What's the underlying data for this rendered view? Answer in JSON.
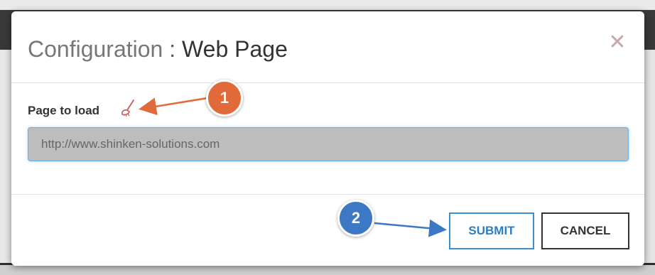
{
  "dialog": {
    "title_prefix": "Configuration",
    "title_separator": " : ",
    "title_main": "Web Page",
    "close_glyph": "✕"
  },
  "form": {
    "page_label": "Page to load",
    "url_placeholder": "http://www.shinken-solutions.com",
    "url_value": ""
  },
  "footer": {
    "submit_label": "SUBMIT",
    "cancel_label": "CANCEL"
  },
  "annotations": {
    "callout_1": "1",
    "callout_2": "2",
    "callout_1_color": "#e06a3a",
    "callout_2_color": "#3d78c4"
  },
  "icons": {
    "close": "close-icon",
    "label_tool": "brush-icon"
  },
  "colors": {
    "submit_accent": "#2a7fc0",
    "input_focus_border": "#66afe9",
    "input_background": "#bdbdbd"
  }
}
